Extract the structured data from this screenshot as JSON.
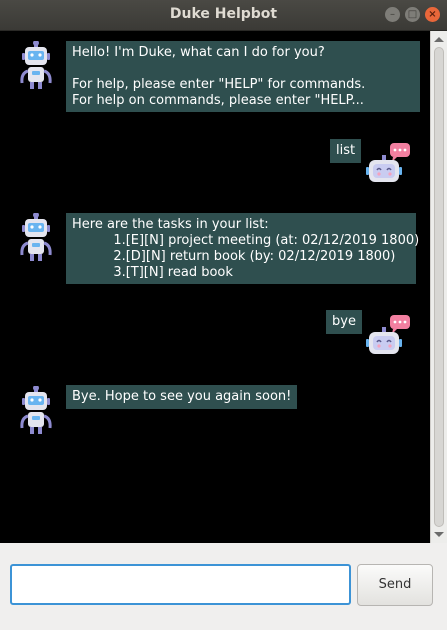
{
  "window": {
    "title": "Duke Helpbot",
    "controls": {
      "minimize": "–",
      "maximize": "□",
      "close": "×"
    }
  },
  "chat": {
    "messages": [
      {
        "sender": "duke",
        "text": "Hello! I'm Duke, what can I do for you?\n\nFor help, please enter \"HELP\" for commands.\nFor help on commands, please enter \"HELP..."
      },
      {
        "sender": "user",
        "text": "list"
      },
      {
        "sender": "duke",
        "text": "Here are the tasks in your list:\n          1.[E][N] project meeting (at: 02/12/2019 1800)\n          2.[D][N] return book (by: 02/12/2019 1800)\n          3.[T][N] read book"
      },
      {
        "sender": "user",
        "text": "bye"
      },
      {
        "sender": "duke",
        "text": "Bye. Hope to see you again soon!"
      }
    ]
  },
  "input": {
    "value": "",
    "placeholder": ""
  },
  "send_button": {
    "label": "Send"
  },
  "colors": {
    "bubble_bg": "#2f4f4f",
    "chat_bg": "#000000",
    "input_focus_border": "#3c93d6",
    "close_button": "#e9673a"
  },
  "icons": {
    "duke_avatar": "robot-avatar-icon",
    "user_avatar": "chat-robot-avatar-icon"
  }
}
